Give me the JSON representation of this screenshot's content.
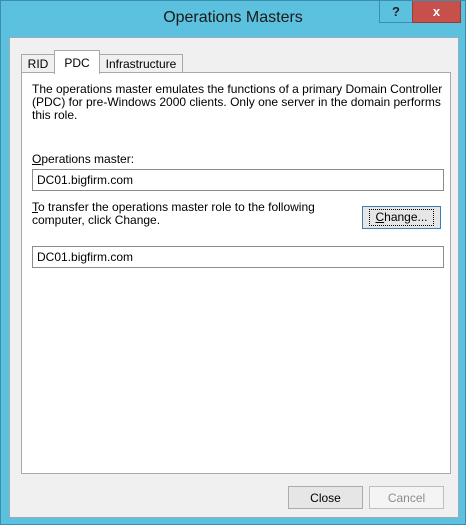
{
  "window": {
    "title": "Operations Masters",
    "help_glyph": "?",
    "close_glyph": "x"
  },
  "tabs": [
    {
      "label": "RID",
      "active": false
    },
    {
      "label": "PDC",
      "active": true
    },
    {
      "label": "Infrastructure",
      "active": false
    }
  ],
  "pdc": {
    "description": "The operations master emulates the functions of a primary Domain Controller (PDC) for pre-Windows 2000 clients. Only one server in the domain performs this role.",
    "ops_master_label_access": "O",
    "ops_master_label_rest": "perations master:",
    "ops_master_value": "DC01.bigfirm.com",
    "transfer_label_access": "T",
    "transfer_label_rest": "o transfer the operations master role to the following computer, click Change.",
    "change_access": "C",
    "change_rest": "hange...",
    "target_value": "DC01.bigfirm.com"
  },
  "footer": {
    "close_label": "Close",
    "cancel_label": "Cancel"
  },
  "colors": {
    "frame": "#5cc0df",
    "close_button": "#c7504a"
  }
}
